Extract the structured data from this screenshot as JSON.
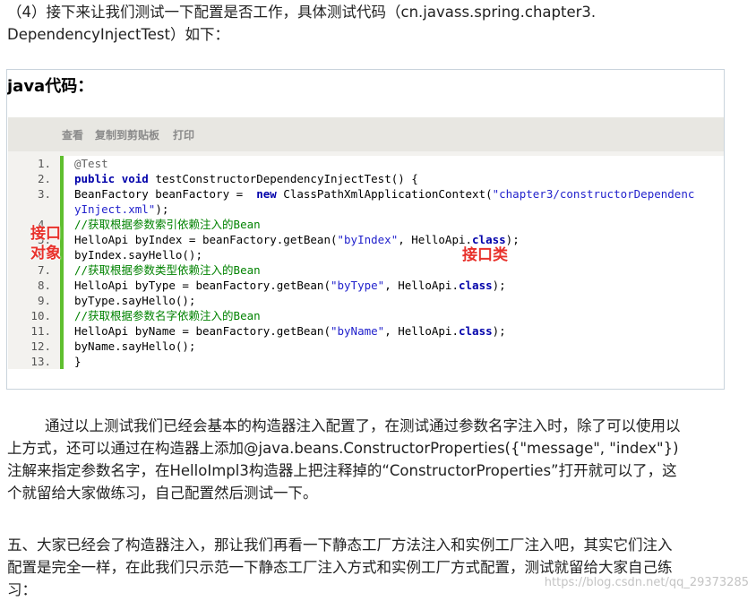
{
  "intro": {
    "line1": "（4）接下来让我们测试一下配置是否工作，具体测试代码（cn.javass.spring.chapter3.",
    "line2": "DependencyInjectTest）如下："
  },
  "code_box": {
    "title": "java代码：",
    "toolbar": {
      "view": "查看",
      "copy": "复制到剪贴板",
      "print": "打印"
    },
    "line_numbers": [
      "1.",
      "2.",
      "3.",
      "4.",
      "5.",
      "6.",
      "7.",
      "8.",
      "9.",
      "10.",
      "11.",
      "12.",
      "13."
    ],
    "lines": [
      [
        {
          "t": "an",
          "v": "@Test"
        }
      ],
      [
        {
          "t": "kw",
          "v": "public"
        },
        {
          "t": "",
          "v": " "
        },
        {
          "t": "kw",
          "v": "void"
        },
        {
          "t": "",
          "v": " testConstructorDependencyInjectTest() {"
        }
      ],
      [
        {
          "t": "",
          "v": "BeanFactory beanFactory =  "
        },
        {
          "t": "kw",
          "v": "new"
        },
        {
          "t": "",
          "v": " ClassPathXmlApplicationContext("
        },
        {
          "t": "str",
          "v": "\"chapter3/constructorDependenc"
        }
      ],
      [
        {
          "t": "str",
          "v": "yInject.xml\""
        },
        {
          "t": "",
          "v": ");"
        }
      ],
      [
        {
          "t": "cm",
          "v": "//获取根据参数索引依赖注入的Bean"
        }
      ],
      [
        {
          "t": "",
          "v": "HelloApi byIndex = beanFactory.getBean("
        },
        {
          "t": "str",
          "v": "\"byIndex\""
        },
        {
          "t": "",
          "v": ", HelloApi."
        },
        {
          "t": "cls",
          "v": "class"
        },
        {
          "t": "",
          "v": ");"
        }
      ],
      [
        {
          "t": "",
          "v": "byIndex.sayHello();"
        }
      ],
      [
        {
          "t": "cm",
          "v": "//获取根据参数类型依赖注入的Bean"
        }
      ],
      [
        {
          "t": "",
          "v": "HelloApi byType = beanFactory.getBean("
        },
        {
          "t": "str",
          "v": "\"byType\""
        },
        {
          "t": "",
          "v": ", HelloApi."
        },
        {
          "t": "cls",
          "v": "class"
        },
        {
          "t": "",
          "v": ");"
        }
      ],
      [
        {
          "t": "",
          "v": "byType.sayHello();"
        }
      ],
      [
        {
          "t": "cm",
          "v": "//获取根据参数名字依赖注入的Bean"
        }
      ],
      [
        {
          "t": "",
          "v": "HelloApi byName = beanFactory.getBean("
        },
        {
          "t": "str",
          "v": "\"byName\""
        },
        {
          "t": "",
          "v": ", HelloApi."
        },
        {
          "t": "cls",
          "v": "class"
        },
        {
          "t": "",
          "v": ");"
        }
      ],
      [
        {
          "t": "",
          "v": "byName.sayHello();"
        }
      ],
      [
        {
          "t": "",
          "v": "}"
        }
      ]
    ],
    "line_number_map": [
      "1.",
      "2.",
      "3.",
      "",
      "4.",
      "5.",
      "6.",
      "7.",
      "8.",
      "9.",
      "10.",
      "11.",
      "12.",
      "13."
    ],
    "annotations": {
      "interface_object_line1": "接口",
      "interface_object_line2": "对象",
      "interface_class": "接口类"
    }
  },
  "para2": {
    "line1": "通过以上测试我们已经会基本的构造器注入配置了，在测试通过参数名字注入时，除了可以使用以",
    "line2": "上方式，还可以通过在构造器上添加@java.beans.ConstructorProperties({\"message\", \"index\"})",
    "line3": "注解来指定参数名字，在HelloImpl3构造器上把注释掉的“ConstructorProperties”打开就可以了，这",
    "line4": "个就留给大家做练习，自己配置然后测试一下。"
  },
  "para3": {
    "line1": "五、大家已经会了构造器注入，那让我们再看一下静态工厂方法注入和实例工厂注入吧，其实它们注入",
    "line2": "配置是完全一样，在此我们只示范一下静态工厂注入方式和实例工厂方式配置，测试就留给大家自己练",
    "line3": "习："
  },
  "watermark": "https://blog.csdn.net/qq_29373285"
}
